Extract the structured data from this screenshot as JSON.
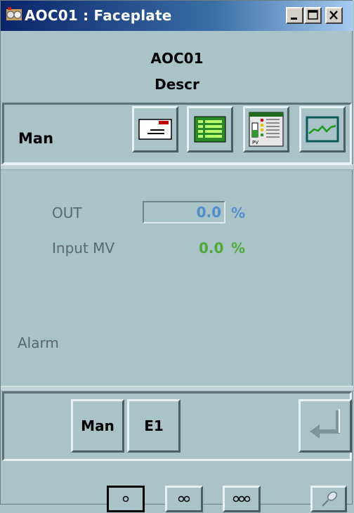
{
  "window": {
    "title": "AOC01 : Faceplate",
    "buttons": [
      "minimize",
      "maximize",
      "close"
    ]
  },
  "header": {
    "tag": "AOC01",
    "description": "Descr"
  },
  "toolbar": {
    "mode": "Man",
    "icons": [
      "message-icon",
      "list-icon",
      "faceplate-icon",
      "trend-icon"
    ]
  },
  "values": {
    "out_label": "OUT",
    "out_value": "0.0",
    "out_unit": "%",
    "mv_label": "Input MV",
    "mv_value": "0.0",
    "mv_unit": "%",
    "alarm_label": "Alarm"
  },
  "controls": {
    "man_label": "Man",
    "e1_label": "E1",
    "enter_icon": "enter-icon"
  },
  "size_buttons": [
    "small-view-icon",
    "medium-view-icon",
    "large-view-icon",
    "pin-icon"
  ],
  "colors": {
    "background": "#a9c3c9",
    "out_value": "#4e8ecb",
    "mv_value": "#4ea83a",
    "title_bar": "#0a246a"
  }
}
